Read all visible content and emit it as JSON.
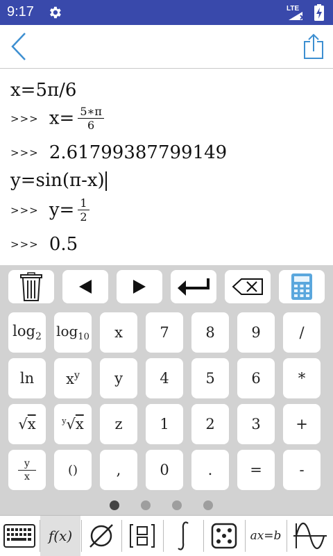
{
  "status": {
    "time": "9:17",
    "network": "LTE"
  },
  "output": {
    "prompt": ">>>",
    "line1": "x=5π/6",
    "line2_lhs": "x=",
    "line2_num": "5∗π",
    "line2_den": "6",
    "line3": "2.61799387799149",
    "line4": "y=sin(π-x)",
    "line5_lhs": "y=",
    "line5_num": "1",
    "line5_den": "2",
    "line6": "0.5"
  },
  "keys": {
    "log2_base": "log",
    "log2_sub": "2",
    "log10_base": "log",
    "log10_sub": "10",
    "x": "x",
    "seven": "7",
    "eight": "8",
    "nine": "9",
    "divide": "/",
    "ln": "ln",
    "pow_base": "x",
    "pow_exp": "y",
    "y": "y",
    "four": "4",
    "five": "5",
    "six": "6",
    "multiply": "*",
    "sqrt_x": "x",
    "nroot_index": "y",
    "nroot_x": "x",
    "z": "z",
    "one": "1",
    "two": "2",
    "three": "3",
    "plus": "+",
    "frac_num": "y",
    "frac_den": "x",
    "parens": "()",
    "comma": ",",
    "zero": "0",
    "dot": ".",
    "equals": "=",
    "minus": "-"
  },
  "tabs": {
    "function_label": "f(x)",
    "equation_label": "ax=b"
  }
}
